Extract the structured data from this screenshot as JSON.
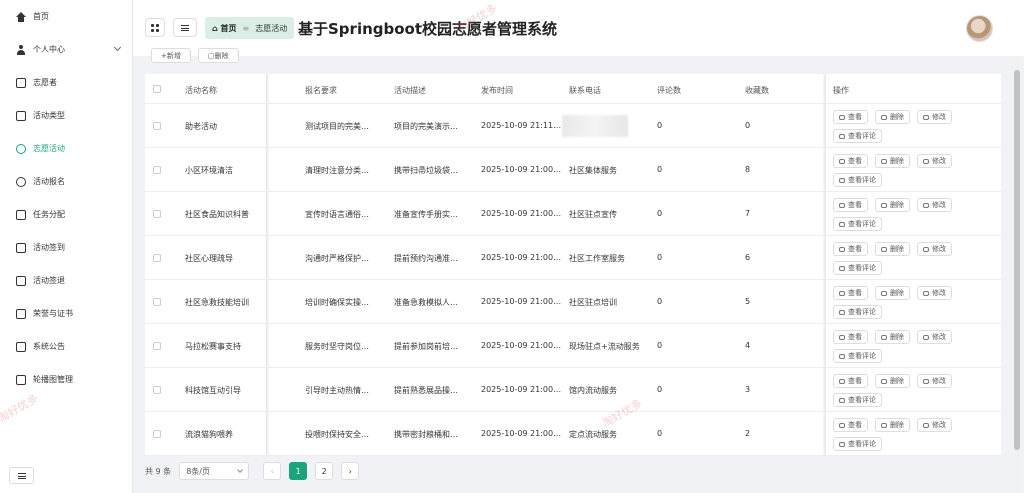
{
  "sidebar": {
    "items": [
      {
        "label": "首页",
        "icon": "home-icon"
      },
      {
        "label": "个人中心",
        "icon": "user-icon"
      },
      {
        "label": "志愿者",
        "icon": "edit-icon"
      },
      {
        "label": "活动类型",
        "icon": "copy-icon"
      },
      {
        "label": "志愿活动",
        "icon": "chat-icon"
      },
      {
        "label": "活动报名",
        "icon": "pie-icon"
      },
      {
        "label": "任务分配",
        "icon": "mail-icon"
      },
      {
        "label": "活动签到",
        "icon": "book-icon"
      },
      {
        "label": "活动签退",
        "icon": "chart-icon"
      },
      {
        "label": "荣誉与证书",
        "icon": "display-icon"
      },
      {
        "label": "系统公告",
        "icon": "building-icon"
      },
      {
        "label": "轮播图管理",
        "icon": "image-icon"
      }
    ]
  },
  "header": {
    "breadcrumb_home": "首页",
    "breadcrumb_current": "志愿活动",
    "system_title": "基于Springboot校园志愿者管理系统"
  },
  "toolbar": {
    "add_label": "新增",
    "delete_label": "删除"
  },
  "table": {
    "columns": [
      "活动名称",
      "报名要求",
      "活动描述",
      "发布时间",
      "联系电话",
      "评论数",
      "收藏数",
      "操作"
    ],
    "rows": [
      {
        "name": "助老活动",
        "req": "测试项目的完美…",
        "desc": "项目的完美演示…",
        "time": "2025-10-09 21:11…",
        "phone": "",
        "comments": "0",
        "favs": "0"
      },
      {
        "name": "小区环境清洁",
        "req": "清理时注意分类…",
        "desc": "携带扫帚垃圾袋…",
        "time": "2025-10-09 21:00…",
        "phone": "社区集体服务",
        "comments": "0",
        "favs": "8"
      },
      {
        "name": "社区食品知识科普",
        "req": "宣传时语言通俗…",
        "desc": "准备宣传手册实…",
        "time": "2025-10-09 21:00…",
        "phone": "社区驻点宣传",
        "comments": "0",
        "favs": "7"
      },
      {
        "name": "社区心理疏导",
        "req": "沟通时严格保护…",
        "desc": "提前预约沟通准…",
        "time": "2025-10-09 21:00…",
        "phone": "社区工作室服务",
        "comments": "0",
        "favs": "6"
      },
      {
        "name": "社区急救技能培训",
        "req": "培训时确保实操…",
        "desc": "准备急救模拟人…",
        "time": "2025-10-09 21:00…",
        "phone": "社区驻点培训",
        "comments": "0",
        "favs": "5"
      },
      {
        "name": "马拉松赛事支持",
        "req": "服务时坚守岗位…",
        "desc": "提前参加岗前培…",
        "time": "2025-10-09 21:00…",
        "phone": "现场驻点+流动服务",
        "comments": "0",
        "favs": "4"
      },
      {
        "name": "科技馆互动引导",
        "req": "引导时主动热情…",
        "desc": "提前熟悉展品操…",
        "time": "2025-10-09 21:00…",
        "phone": "馆内流动服务",
        "comments": "0",
        "favs": "3"
      },
      {
        "name": "流浪猫狗喂养",
        "req": "投喂时保持安全…",
        "desc": "携带密封粮桶和…",
        "time": "2025-10-09 21:00…",
        "phone": "定点流动服务",
        "comments": "0",
        "favs": "2"
      }
    ],
    "op_view": "查看",
    "op_delete": "删除",
    "op_edit": "修改",
    "op_comments": "查看评论"
  },
  "pagination": {
    "total_text": "共 9 条",
    "page_size": "8条/页",
    "pages": [
      "1",
      "2"
    ],
    "current": "1"
  },
  "watermark": "淘好优多",
  "accent_color": "#1aa57c"
}
